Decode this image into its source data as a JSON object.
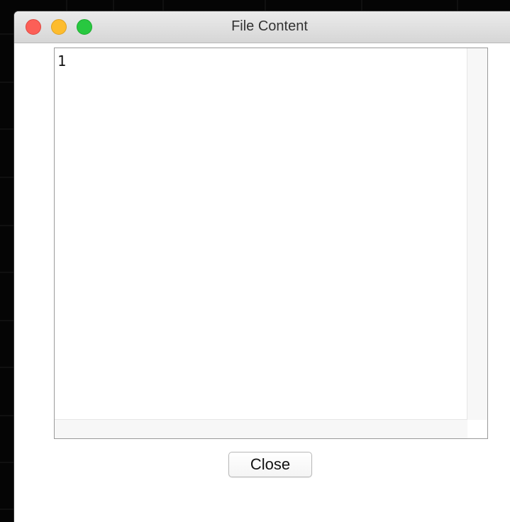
{
  "background": {
    "partial_text_left": "",
    "partial_text_right": ""
  },
  "window": {
    "title": "File Content"
  },
  "text_area": {
    "content": "1"
  },
  "buttons": {
    "close_label": "Close"
  },
  "colors": {
    "traffic_close": "#fc5f57",
    "traffic_minimize": "#fdbc2e",
    "traffic_maximize": "#28c840"
  }
}
